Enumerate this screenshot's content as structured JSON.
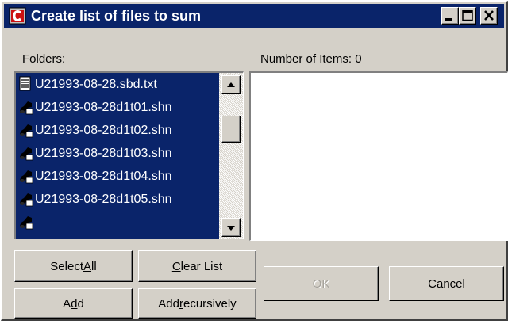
{
  "window": {
    "title": "Create list of files to sum",
    "icons": {
      "app": "document-c-icon",
      "minimize": "minimize-icon",
      "maximize": "maximize-icon",
      "close": "close-icon"
    },
    "colors": {
      "titlebar": "#0a246a",
      "face": "#d4d0c8",
      "selection": "#0a246a"
    }
  },
  "folders_label": "Folders:",
  "items_label": "Number of Items: 0",
  "file_list": {
    "items": [
      {
        "name": "U21993-08-28.sbd.txt",
        "icon": "text-file-icon"
      },
      {
        "name": "U21993-08-28d1t01.shn",
        "icon": "audio-file-icon"
      },
      {
        "name": "U21993-08-28d1t02.shn",
        "icon": "audio-file-icon"
      },
      {
        "name": "U21993-08-28d1t03.shn",
        "icon": "audio-file-icon"
      },
      {
        "name": "U21993-08-28d1t04.shn",
        "icon": "audio-file-icon"
      },
      {
        "name": "U21993-08-28d1t05.shn",
        "icon": "audio-file-icon"
      },
      {
        "name": "",
        "icon": "audio-file-icon"
      }
    ],
    "scroll_icons": {
      "up": "scroll-up-arrow-icon",
      "down": "scroll-down-arrow-icon"
    }
  },
  "buttons": {
    "select_all": {
      "pre": "Select ",
      "acc": "A",
      "post": "ll"
    },
    "clear_list": {
      "pre": "",
      "acc": "C",
      "post": "lear List"
    },
    "add": {
      "pre": "A",
      "acc": "d",
      "post": "d"
    },
    "add_recursively": {
      "pre": "Add ",
      "acc": "r",
      "post": "ecursively"
    },
    "ok": {
      "label": "OK"
    },
    "cancel": {
      "label": "Cancel"
    }
  }
}
